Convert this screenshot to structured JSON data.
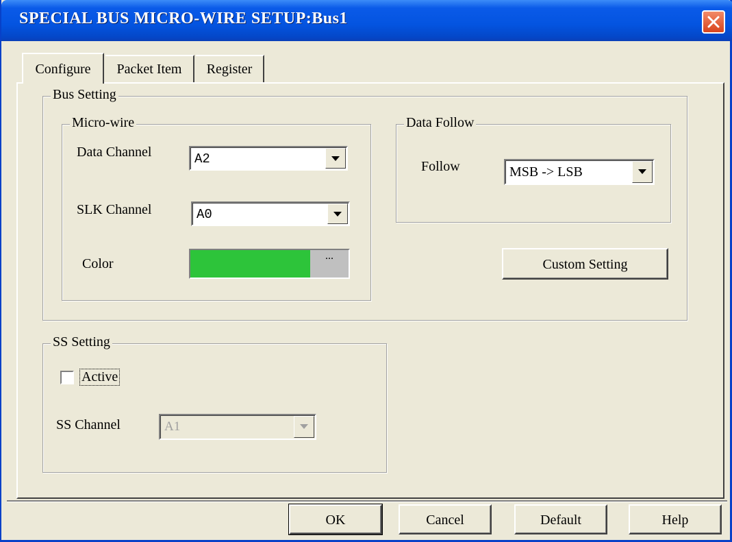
{
  "window": {
    "title": "SPECIAL BUS MICRO-WIRE SETUP:Bus1"
  },
  "tabs": [
    {
      "label": "Configure"
    },
    {
      "label": "Packet Item"
    },
    {
      "label": "Register"
    }
  ],
  "bus_setting": {
    "label": "Bus Setting",
    "micro_wire": {
      "label": "Micro-wire",
      "data_channel_label": "Data Channel",
      "data_channel_value": "A2",
      "slk_channel_label": "SLK Channel",
      "slk_channel_value": "A0",
      "color_label": "Color",
      "color_value": "#2DC43A",
      "color_more": "..."
    },
    "data_follow": {
      "label": "Data Follow",
      "follow_label": "Follow",
      "follow_value": "MSB -> LSB"
    },
    "custom_setting": "Custom Setting"
  },
  "ss_setting": {
    "label": "SS Setting",
    "active_label": "Active",
    "active_checked": false,
    "ss_channel_label": "SS Channel",
    "ss_channel_value": "A1"
  },
  "buttons": {
    "ok": "OK",
    "cancel": "Cancel",
    "default": "Default",
    "help": "Help"
  }
}
